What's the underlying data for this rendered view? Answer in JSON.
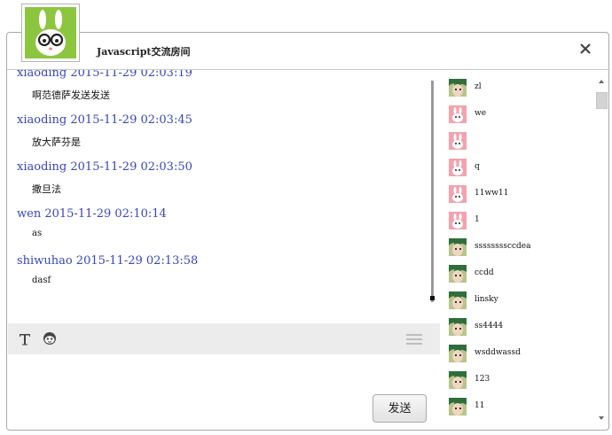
{
  "room": {
    "title": "Javascript交流房间"
  },
  "messages": [
    {
      "user": "xiaoding",
      "time": "2015-11-29 02:03:19",
      "text": "啊范德萨发送发送"
    },
    {
      "user": "xiaoding",
      "time": "2015-11-29 02:03:45",
      "text": "放大萨芬是"
    },
    {
      "user": "xiaoding",
      "time": "2015-11-29 02:03:50",
      "text": "撒旦法"
    },
    {
      "user": "wen",
      "time": "2015-11-29 02:10:14",
      "text": "as"
    },
    {
      "user": "shiwuhao",
      "time": "2015-11-29 02:13:58",
      "text": "dasf"
    }
  ],
  "toolbar": {
    "font_icon": "T"
  },
  "send": {
    "label": "发送"
  },
  "users": [
    {
      "name": "zl",
      "avatar": "green-avatar"
    },
    {
      "name": "we",
      "avatar": "pink-rabbit-avatar"
    },
    {
      "name": "",
      "avatar": "pink-rabbit-avatar"
    },
    {
      "name": "q",
      "avatar": "pink-rabbit-avatar"
    },
    {
      "name": "11ww11",
      "avatar": "pink-rabbit-avatar"
    },
    {
      "name": "1",
      "avatar": "pink-rabbit-avatar"
    },
    {
      "name": "ssssssssccdea",
      "avatar": "green-avatar"
    },
    {
      "name": "ccdd",
      "avatar": "green-avatar"
    },
    {
      "name": "linsky",
      "avatar": "green-avatar"
    },
    {
      "name": "ss4444",
      "avatar": "green-avatar"
    },
    {
      "name": "wsddwassd",
      "avatar": "green-avatar"
    },
    {
      "name": "123",
      "avatar": "green-avatar"
    },
    {
      "name": "11",
      "avatar": "green-avatar"
    }
  ],
  "colors": {
    "accent": "#3946b8",
    "avatar_bg": "#8cc63f",
    "toolbar_bg": "#ececec"
  }
}
